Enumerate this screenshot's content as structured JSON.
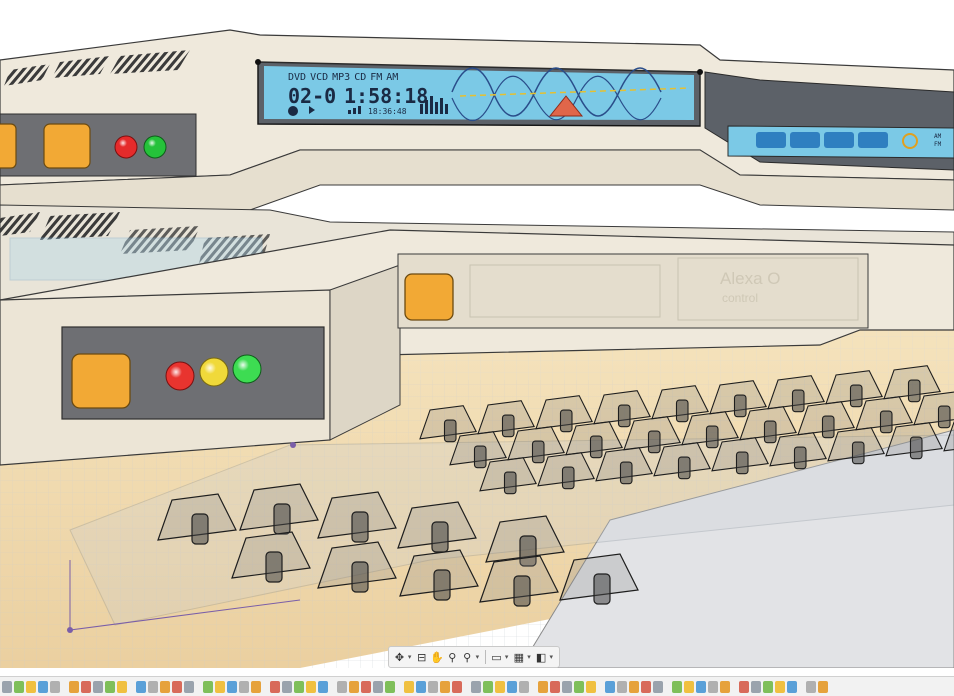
{
  "app": {
    "name": ""
  },
  "lcd": {
    "mode_labels": [
      "DVD",
      "VCD",
      "MP3",
      "CD",
      "FM",
      "AM"
    ],
    "track": "02-0",
    "time": "1:58:18",
    "sub_time": "18:36:48"
  },
  "right_panel": {
    "labels": [
      "AM",
      "FM"
    ]
  },
  "upper_console": {
    "led_colors": [
      "#e52b2b",
      "#25c23a"
    ]
  },
  "lower_console": {
    "led_colors": [
      "#e8342f",
      "#f0d93a",
      "#3ddc52"
    ],
    "engraving": "Alexa O",
    "engraving_line2": "control"
  },
  "colors": {
    "panel_cream": "#efe9dc",
    "panel_dark": "#6e6f73",
    "button_orange": "#f2a935",
    "lcd_bg": "#7bc9e6",
    "floor": "#e9c891"
  },
  "nav_toolbar": {
    "tools": [
      "orbit-icon",
      "look-at-icon",
      "pan-icon",
      "zoom-icon",
      "fit-icon",
      "display-settings-icon",
      "grid-settings-icon",
      "viewports-icon"
    ]
  },
  "bottom_toolbar": {
    "tools": [
      "timeline-controls"
    ]
  }
}
